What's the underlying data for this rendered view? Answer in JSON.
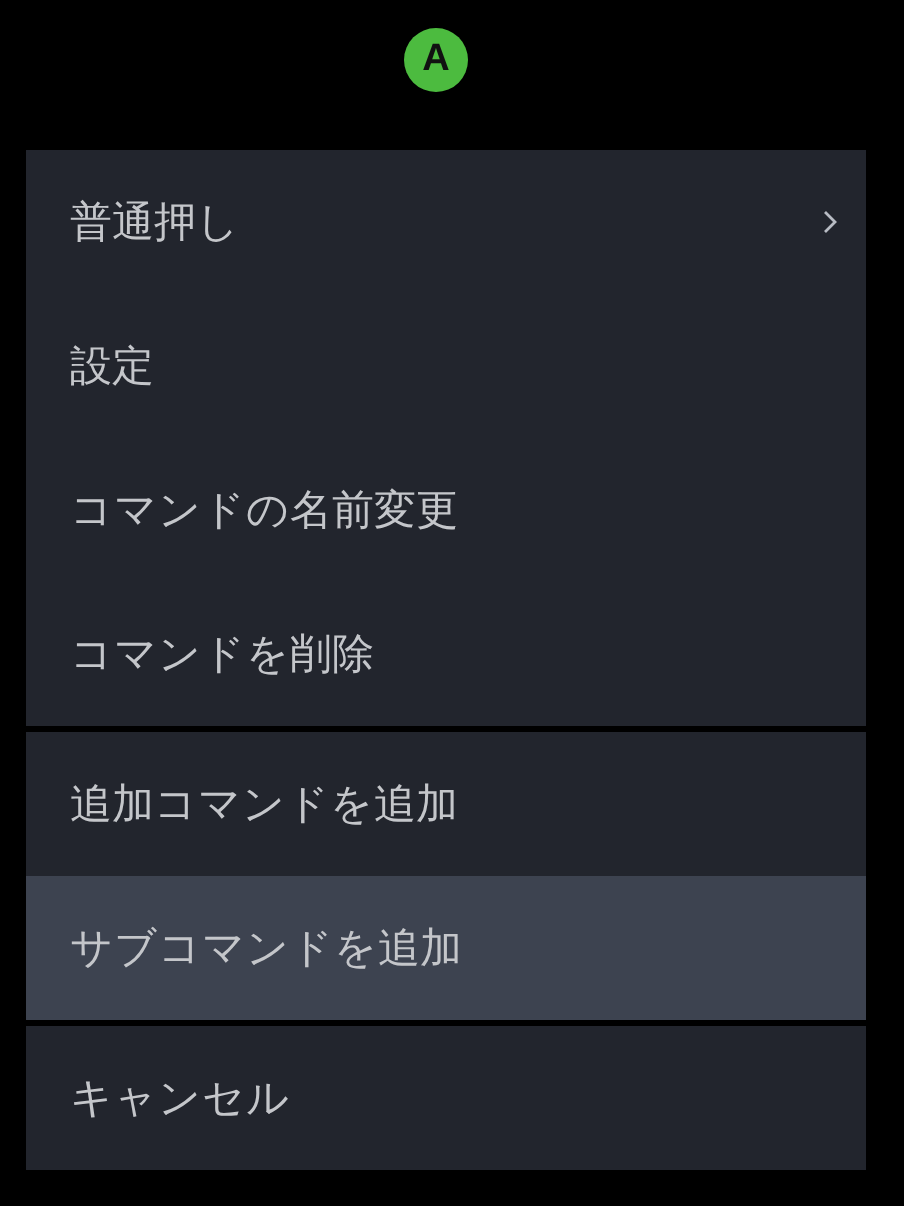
{
  "badge": {
    "label": "A",
    "color": "#4cbb3f"
  },
  "menu": {
    "groups": [
      {
        "items": [
          {
            "label": "普通押し",
            "selected": false,
            "submenu": true
          },
          {
            "label": "設定",
            "selected": false,
            "submenu": false
          },
          {
            "label": "コマンドの名前変更",
            "selected": false,
            "submenu": false
          },
          {
            "label": "コマンドを削除",
            "selected": false,
            "submenu": false
          }
        ]
      },
      {
        "items": [
          {
            "label": "追加コマンドを追加",
            "selected": false,
            "submenu": false
          },
          {
            "label": "サブコマンドを追加",
            "selected": true,
            "submenu": false
          }
        ]
      },
      {
        "items": [
          {
            "label": "キャンセル",
            "selected": false,
            "submenu": false
          }
        ]
      }
    ]
  }
}
